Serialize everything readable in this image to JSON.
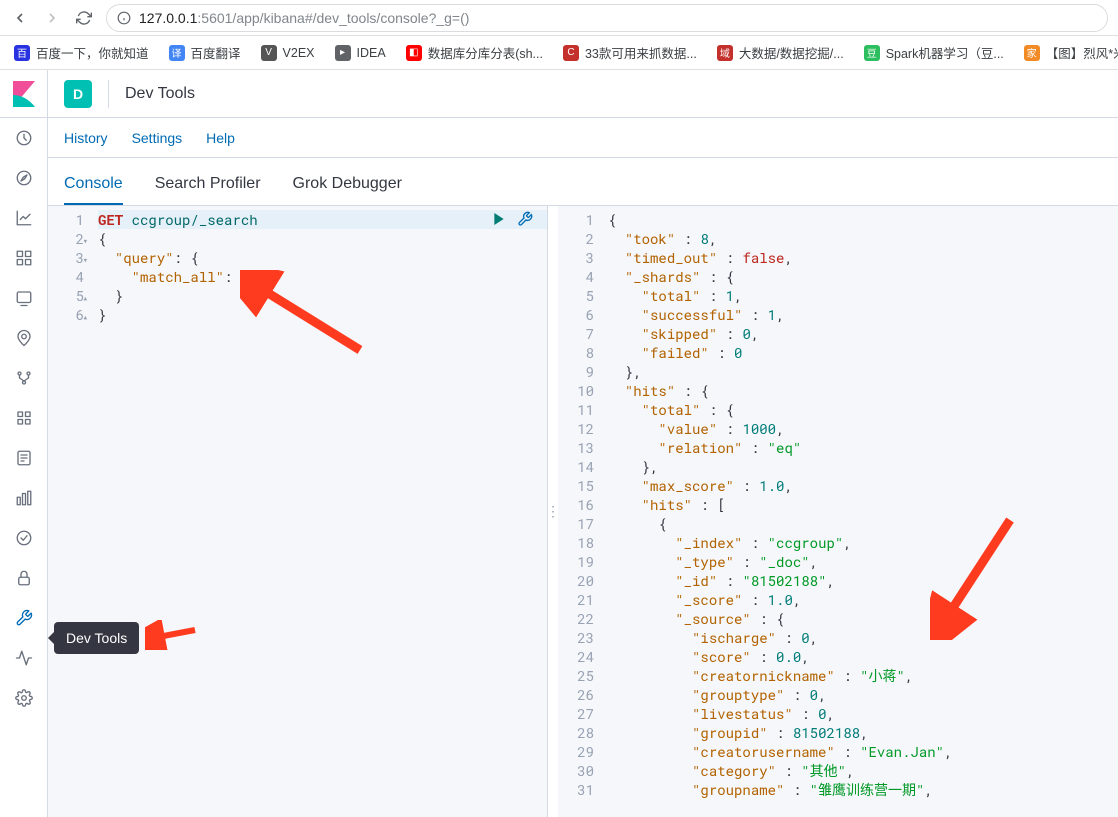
{
  "browser": {
    "url_host": "127.0.0.1",
    "url_path": ":5601/app/kibana#/dev_tools/console?_g=()"
  },
  "bookmarks": [
    {
      "label": "百度一下，你就知道",
      "color": "#2932e1"
    },
    {
      "label": "百度翻译",
      "color": "#4285f4"
    },
    {
      "label": "V2EX",
      "color": "#555"
    },
    {
      "label": "IDEA",
      "color": "#000",
      "folder": true
    },
    {
      "label": "数据库分库分表(sh...",
      "color": "#f00"
    },
    {
      "label": "33款可用来抓数据...",
      "color": "#c4302b"
    },
    {
      "label": "大数据/数据挖掘/...",
      "color": "#c4302b"
    },
    {
      "label": "Spark机器学习（豆...",
      "color": "#2dbe60"
    },
    {
      "label": "【图】烈风*米格"
    }
  ],
  "header": {
    "space_initial": "D",
    "breadcrumb": "Dev Tools"
  },
  "menus": [
    "History",
    "Settings",
    "Help"
  ],
  "tabs": [
    {
      "label": "Console",
      "active": true
    },
    {
      "label": "Search Profiler",
      "active": false
    },
    {
      "label": "Grok Debugger",
      "active": false
    }
  ],
  "tooltip": "Dev Tools",
  "request": {
    "lines": [
      {
        "n": 1,
        "html": "<span class='tok-method'>GET</span> <span class='tok-url'>ccgroup/_search</span>",
        "hl": true
      },
      {
        "n": 2,
        "fold": "open",
        "html": "{"
      },
      {
        "n": 3,
        "fold": "open",
        "html": "  <span class='tok-key'>\"query\"</span>: {"
      },
      {
        "n": 4,
        "html": "    <span class='tok-key'>\"match_all\"</span>: {}"
      },
      {
        "n": 5,
        "fold": "close",
        "html": "  }"
      },
      {
        "n": 6,
        "fold": "close",
        "html": "}"
      }
    ]
  },
  "response": {
    "lines": [
      {
        "n": 1,
        "html": "{"
      },
      {
        "n": 2,
        "html": "  <span class='tok-key'>\"took\"</span> : <span class='tok-num'>8</span>,"
      },
      {
        "n": 3,
        "html": "  <span class='tok-key'>\"timed_out\"</span> : <span class='tok-bool'>false</span>,"
      },
      {
        "n": 4,
        "html": "  <span class='tok-key'>\"_shards\"</span> : {"
      },
      {
        "n": 5,
        "html": "    <span class='tok-key'>\"total\"</span> : <span class='tok-num'>1</span>,"
      },
      {
        "n": 6,
        "html": "    <span class='tok-key'>\"successful\"</span> : <span class='tok-num'>1</span>,"
      },
      {
        "n": 7,
        "html": "    <span class='tok-key'>\"skipped\"</span> : <span class='tok-num'>0</span>,"
      },
      {
        "n": 8,
        "html": "    <span class='tok-key'>\"failed\"</span> : <span class='tok-num'>0</span>"
      },
      {
        "n": 9,
        "html": "  },"
      },
      {
        "n": 10,
        "html": "  <span class='tok-key'>\"hits\"</span> : {"
      },
      {
        "n": 11,
        "html": "    <span class='tok-key'>\"total\"</span> : {"
      },
      {
        "n": 12,
        "html": "      <span class='tok-key'>\"value\"</span> : <span class='tok-num'>1000</span>,"
      },
      {
        "n": 13,
        "html": "      <span class='tok-key'>\"relation\"</span> : <span class='tok-str'>\"eq\"</span>"
      },
      {
        "n": 14,
        "html": "    },"
      },
      {
        "n": 15,
        "html": "    <span class='tok-key'>\"max_score\"</span> : <span class='tok-num'>1.0</span>,"
      },
      {
        "n": 16,
        "html": "    <span class='tok-key'>\"hits\"</span> : ["
      },
      {
        "n": 17,
        "html": "      {"
      },
      {
        "n": 18,
        "html": "        <span class='tok-key'>\"_index\"</span> : <span class='tok-str'>\"ccgroup\"</span>,"
      },
      {
        "n": 19,
        "html": "        <span class='tok-key'>\"_type\"</span> : <span class='tok-str'>\"_doc\"</span>,"
      },
      {
        "n": 20,
        "html": "        <span class='tok-key'>\"_id\"</span> : <span class='tok-str'>\"81502188\"</span>,"
      },
      {
        "n": 21,
        "html": "        <span class='tok-key'>\"_score\"</span> : <span class='tok-num'>1.0</span>,"
      },
      {
        "n": 22,
        "html": "        <span class='tok-key'>\"_source\"</span> : {"
      },
      {
        "n": 23,
        "html": "          <span class='tok-key'>\"ischarge\"</span> : <span class='tok-num'>0</span>,"
      },
      {
        "n": 24,
        "html": "          <span class='tok-key'>\"score\"</span> : <span class='tok-num'>0.0</span>,"
      },
      {
        "n": 25,
        "html": "          <span class='tok-key'>\"creatornickname\"</span> : <span class='tok-str'>\"小蒋\"</span>,"
      },
      {
        "n": 26,
        "html": "          <span class='tok-key'>\"grouptype\"</span> : <span class='tok-num'>0</span>,"
      },
      {
        "n": 27,
        "html": "          <span class='tok-key'>\"livestatus\"</span> : <span class='tok-num'>0</span>,"
      },
      {
        "n": 28,
        "html": "          <span class='tok-key'>\"groupid\"</span> : <span class='tok-num'>81502188</span>,"
      },
      {
        "n": 29,
        "html": "          <span class='tok-key'>\"creatorusername\"</span> : <span class='tok-str'>\"Evan.Jan\"</span>,"
      },
      {
        "n": 30,
        "html": "          <span class='tok-key'>\"category\"</span> : <span class='tok-str'>\"其他\"</span>,"
      },
      {
        "n": 31,
        "html": "          <span class='tok-key'>\"groupname\"</span> : <span class='tok-str'>\"雏鹰训练营一期\"</span>,"
      }
    ]
  },
  "sidebar_icons": [
    "recent",
    "discover",
    "visualize",
    "dashboard",
    "canvas",
    "maps",
    "ml",
    "infra",
    "logs",
    "apm",
    "uptime",
    "siem",
    "devtools",
    "monitoring",
    "management"
  ]
}
